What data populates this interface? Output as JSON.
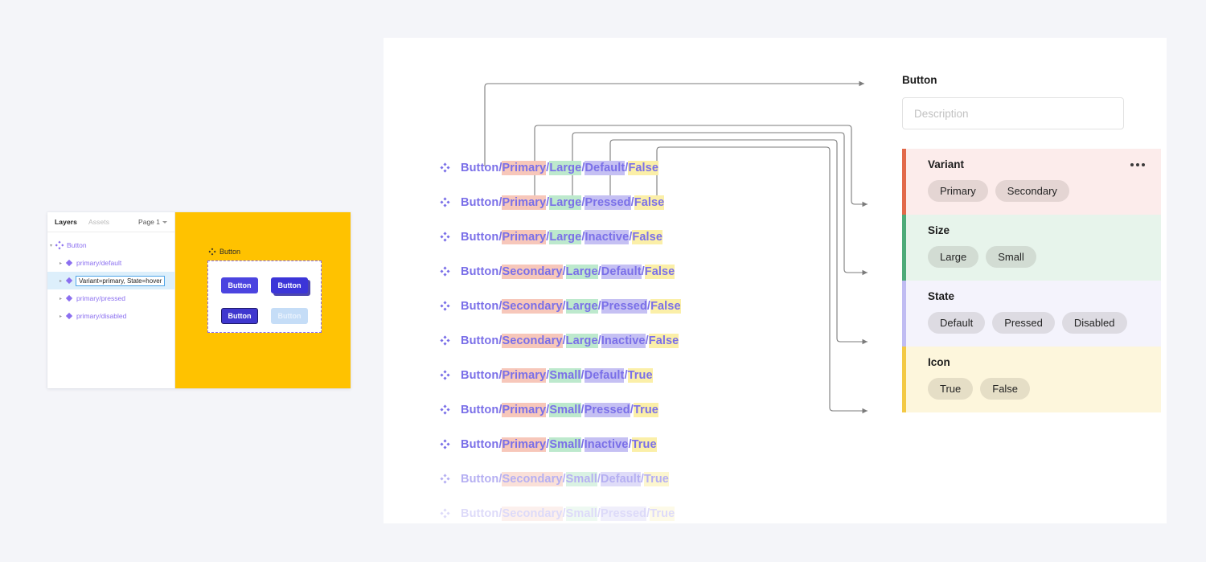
{
  "colors": {
    "page_bg": "#f4f5f9",
    "canvas_yellow": "#ffc200",
    "variant_accent": "#e2694a",
    "size_accent": "#4eab79",
    "state_accent": "#c0bcf2",
    "icon_accent": "#f3c945",
    "component_purple": "#8b6ff0",
    "button_primary": "#4b44e0",
    "button_disabled": "#c5ddf7"
  },
  "layers_panel": {
    "tabs": [
      {
        "label": "Layers",
        "active": true
      },
      {
        "label": "Assets",
        "active": false
      }
    ],
    "page_selector": "Page 1",
    "page_caret_icon": "chevron-down-icon",
    "rows": [
      {
        "label": "Button",
        "icon": "component-set-icon",
        "depth": 0,
        "selected": false,
        "expanded": true
      },
      {
        "label": "primary/default",
        "icon": "component-icon",
        "depth": 1,
        "selected": false,
        "expanded": false
      },
      {
        "label": "Variant=primary, State=hover",
        "icon": "component-icon",
        "depth": 1,
        "selected": true,
        "expanded": false
      },
      {
        "label": "primary/pressed",
        "icon": "component-icon",
        "depth": 1,
        "selected": false,
        "expanded": false
      },
      {
        "label": "primary/disabled",
        "icon": "component-icon",
        "depth": 1,
        "selected": false,
        "expanded": false
      }
    ]
  },
  "canvas": {
    "frame_title": "Button",
    "frame_icon": "component-set-icon",
    "buttons": [
      {
        "label": "Button",
        "state": "default"
      },
      {
        "label": "Button",
        "state": "hover"
      },
      {
        "label": "Button",
        "state": "pressed"
      },
      {
        "label": "Button",
        "state": "disabled"
      }
    ]
  },
  "variant_list": {
    "item_icon": "component-icon",
    "rows": [
      {
        "prefix": "Button",
        "variant": "Primary",
        "size": "Large",
        "state": "Default",
        "icon": "False",
        "opacity": 1.0
      },
      {
        "prefix": "Button",
        "variant": "Primary",
        "size": "Large",
        "state": "Pressed",
        "icon": "False",
        "opacity": 1.0
      },
      {
        "prefix": "Button",
        "variant": "Primary",
        "size": "Large",
        "state": "Inactive",
        "icon": "False",
        "opacity": 1.0
      },
      {
        "prefix": "Button",
        "variant": "Secondary",
        "size": "Large",
        "state": "Default",
        "icon": "False",
        "opacity": 1.0
      },
      {
        "prefix": "Button",
        "variant": "Secondary",
        "size": "Large",
        "state": "Pressed",
        "icon": "False",
        "opacity": 1.0
      },
      {
        "prefix": "Button",
        "variant": "Secondary",
        "size": "Large",
        "state": "Inactive",
        "icon": "False",
        "opacity": 1.0
      },
      {
        "prefix": "Button",
        "variant": "Primary",
        "size": "Small",
        "state": "Default",
        "icon": "True",
        "opacity": 1.0
      },
      {
        "prefix": "Button",
        "variant": "Primary",
        "size": "Small",
        "state": "Pressed",
        "icon": "True",
        "opacity": 1.0
      },
      {
        "prefix": "Button",
        "variant": "Primary",
        "size": "Small",
        "state": "Inactive",
        "icon": "True",
        "opacity": 1.0
      },
      {
        "prefix": "Button",
        "variant": "Secondary",
        "size": "Small",
        "state": "Default",
        "icon": "True",
        "opacity": 0.55
      },
      {
        "prefix": "Button",
        "variant": "Secondary",
        "size": "Small",
        "state": "Pressed",
        "icon": "True",
        "opacity": 0.25
      }
    ],
    "separator": "/"
  },
  "properties": {
    "title": "Button",
    "description_placeholder": "Description",
    "description_value": "",
    "menu_icon": "more-horizontal-icon",
    "groups": [
      {
        "name": "Variant",
        "key": "variant",
        "values": [
          "Primary",
          "Secondary"
        ],
        "has_menu": true
      },
      {
        "name": "Size",
        "key": "size",
        "values": [
          "Large",
          "Small"
        ],
        "has_menu": false
      },
      {
        "name": "State",
        "key": "state",
        "values": [
          "Default",
          "Pressed",
          "Disabled"
        ],
        "has_menu": false
      },
      {
        "name": "Icon",
        "key": "icon",
        "values": [
          "True",
          "False"
        ],
        "has_menu": false
      }
    ]
  }
}
